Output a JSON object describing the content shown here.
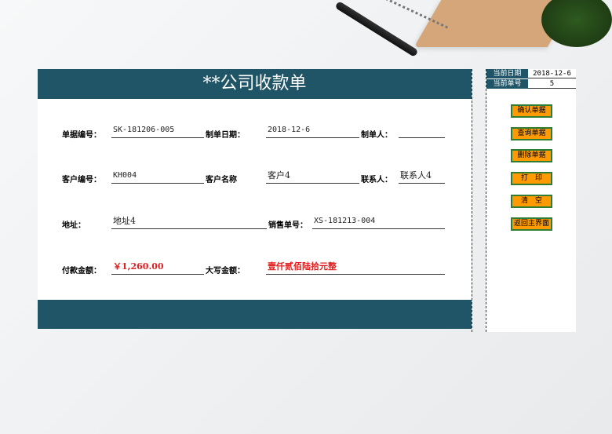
{
  "form": {
    "title": "**公司收款单",
    "receipt_no": {
      "label": "单据编号：",
      "value": "SK-181206-005"
    },
    "doc_date": {
      "label": "制单日期：",
      "value": "2018-12-6"
    },
    "creator": {
      "label": "制单人：",
      "value": ""
    },
    "customer_no": {
      "label": "客户编号：",
      "value": "KH004"
    },
    "customer_name": {
      "label": "客户名称",
      "value": "客户4"
    },
    "contact": {
      "label": "联系人：",
      "value": "联系人4"
    },
    "address": {
      "label": "地址：",
      "value": "地址4"
    },
    "sales_no": {
      "label": "销售单号：",
      "value": "XS-181213-004"
    },
    "payment_amount": {
      "label": "付款金额：",
      "value": "￥1,260.00"
    },
    "amount_words": {
      "label": "大写金额：",
      "value": "壹仟贰佰陆拾元整"
    }
  },
  "panel": {
    "current_date": {
      "label": "当前日期",
      "value": "2018-12-6"
    },
    "current_no": {
      "label": "当前单号",
      "value": "5"
    },
    "buttons": [
      "确认单据",
      "查询单据",
      "删除单据",
      "打　印",
      "清　空",
      "返回主界面"
    ]
  },
  "colors": {
    "header": "#1f5566",
    "button": "#ff9a00",
    "button_border": "#2e7d32",
    "amount": "#e02020"
  }
}
